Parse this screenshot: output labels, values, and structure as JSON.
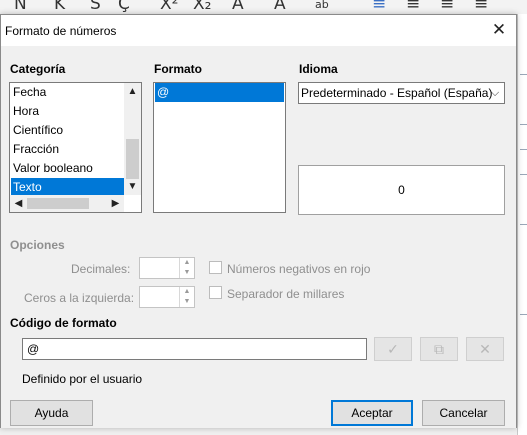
{
  "background_toolbar": {
    "glyphs": [
      "N",
      "K",
      "S",
      "Ç",
      "X²",
      "X₂",
      "A",
      "A",
      "ab",
      "≡",
      "≡",
      "≡",
      "≡"
    ]
  },
  "dialog": {
    "title": "Formato de números",
    "close_icon": "close-icon"
  },
  "categoria": {
    "label": "Categoría",
    "items": [
      "Fecha",
      "Hora",
      "Científico",
      "Fracción",
      "Valor booleano",
      "Texto"
    ],
    "selected": "Texto"
  },
  "formato": {
    "label": "Formato",
    "items": [
      "@"
    ],
    "selected": "@"
  },
  "idioma": {
    "label": "Idioma",
    "value": "Predeterminado - Español (España)"
  },
  "preview": {
    "value": "0"
  },
  "opciones": {
    "label": "Opciones",
    "decimales_label": "Decimales:",
    "decimales_value": "",
    "ceros_label": "Ceros a la izquierda:",
    "ceros_value": "",
    "negativos_rojo_label": "Números negativos en rojo",
    "negativos_rojo_checked": false,
    "separador_label": "Separador de millares",
    "separador_checked": false
  },
  "codigo": {
    "label": "Código de formato",
    "value": "@",
    "status": "Definido por el usuario"
  },
  "buttons": {
    "ayuda": "Ayuda",
    "aceptar": "Aceptar",
    "cancelar": "Cancelar"
  },
  "colors": {
    "accent": "#0078d7",
    "disabled_text": "#8f8f8f"
  }
}
